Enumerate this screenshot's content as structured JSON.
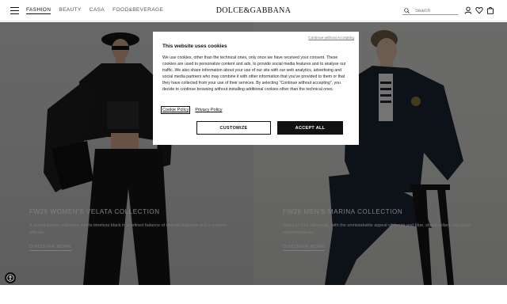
{
  "header": {
    "nav": [
      {
        "label": "FASHION",
        "active": true
      },
      {
        "label": "BEAUTY",
        "active": false
      },
      {
        "label": "CASA",
        "active": false
      },
      {
        "label": "FOOD&BEVERAGE",
        "active": false
      }
    ],
    "logo": "DOLCE&GABBANA",
    "search_placeholder": "Search",
    "icons": [
      "menu-icon",
      "search-icon",
      "user-icon",
      "heart-icon",
      "bag-icon"
    ]
  },
  "hero": {
    "left": {
      "title": "FW26 WOMEN'S VELATA COLLECTION",
      "description": "A strong fashion influence meets timeless black in a refined balance of natural elegance and a modern attitude.",
      "link": "DISCOVER MORE"
    },
    "right": {
      "title": "FW26 MEN'S MARINA COLLECTION",
      "description": "Sharp in their silhouette, with the unmistakable appeal of denim and blue, shawl collars' signature embellishments.",
      "link": "DISCOVER MORE"
    }
  },
  "modal": {
    "continue_label": "Continue without Accepting",
    "title": "This website uses cookies",
    "body": "We use cookies, other than the technical ones, only once we have received your consent. These cookies are used to personalize content and ads, to provide social media features and to analyse our traffic. We also share information about your use of our site with our web analytics, advertising and social media partners who may combine it with other information that you've provided to them or that they have collected from your use of their services. By selecting \"Continue without accepting\", you decide to continue browsing without installing additional cookies other than the technical ones.",
    "cookie_policy": "Cookie Policy",
    "privacy_policy": "Privacy Policy",
    "customize_label": "CUSTOMIZE",
    "accept_label": "ACCEPT ALL"
  },
  "colors": {
    "text": "#111111",
    "overlay": "rgba(0,0,0,0.5)",
    "accept_bg": "#111111"
  }
}
